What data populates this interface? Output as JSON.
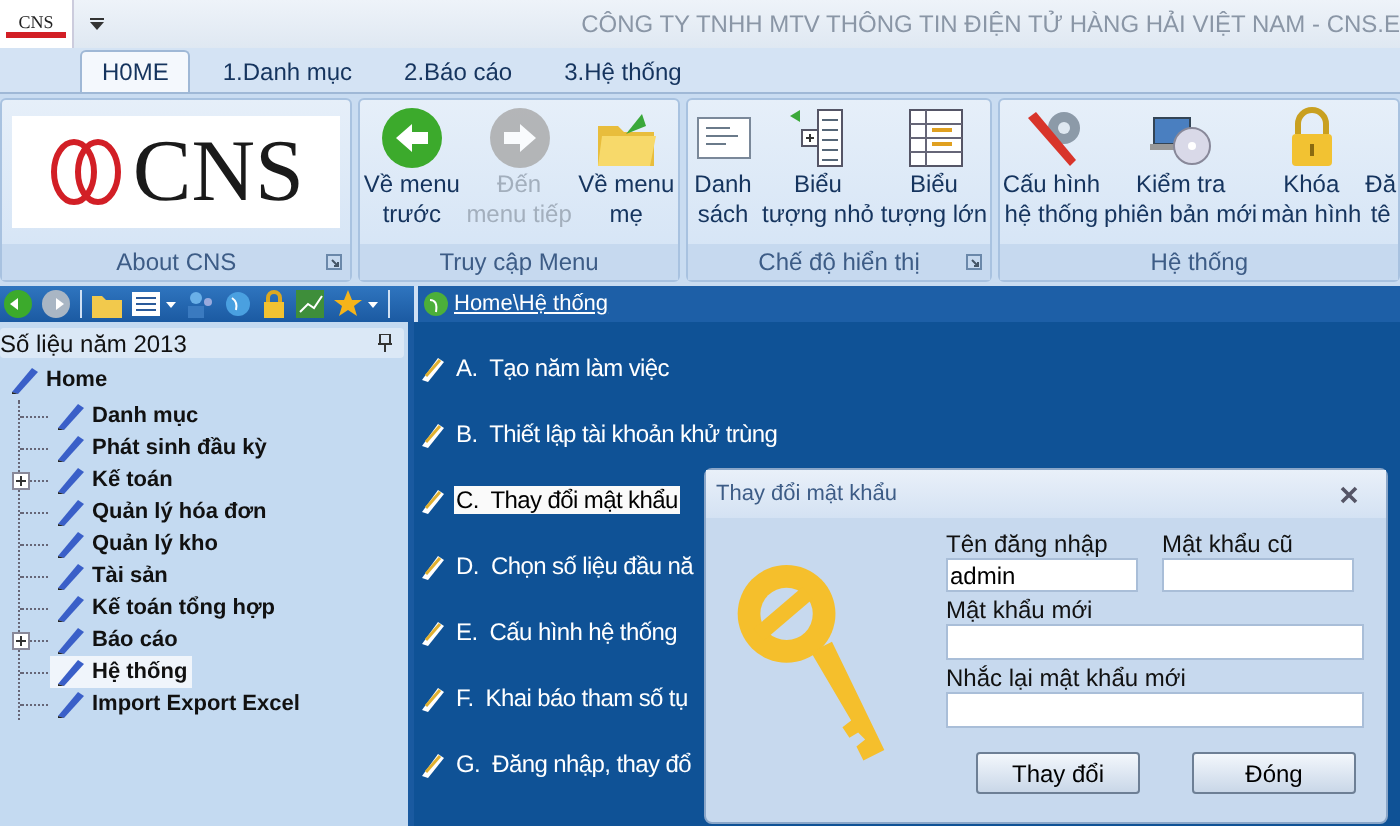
{
  "window": {
    "app_logo_text": "CNS",
    "title": "CÔNG TY TNHH MTV THÔNG TIN ĐIỆN TỬ HÀNG HẢI VIỆT NAM - CNS.E"
  },
  "tabs": [
    {
      "label": "H0ME",
      "selected": true
    },
    {
      "label": "1.Danh mục",
      "selected": false
    },
    {
      "label": "2.Báo cáo",
      "selected": false
    },
    {
      "label": "3.Hệ thống",
      "selected": false
    }
  ],
  "ribbon": [
    {
      "kind": "logo",
      "label": "About CNS",
      "logo_text": "CNS",
      "launcher": true
    },
    {
      "kind": "buttons",
      "label": "Truy cập Menu",
      "launcher": false,
      "buttons": [
        {
          "lines": [
            "Về menu",
            "trước"
          ],
          "disabled": false
        },
        {
          "lines": [
            "Đến",
            "menu tiếp"
          ],
          "disabled": true
        },
        {
          "lines": [
            "Về menu",
            "mẹ"
          ],
          "disabled": false
        }
      ]
    },
    {
      "kind": "buttons",
      "label": "Chế độ hiển thị",
      "launcher": true,
      "buttons": [
        {
          "lines": [
            "Danh",
            "sách"
          ],
          "disabled": false
        },
        {
          "lines": [
            "Biểu",
            "tượng nhỏ"
          ],
          "disabled": false
        },
        {
          "lines": [
            "Biểu",
            "tượng lớn"
          ],
          "disabled": false
        }
      ]
    },
    {
      "kind": "buttons",
      "label": "Hệ thống",
      "launcher": false,
      "buttons": [
        {
          "lines": [
            "Cấu hình",
            "hệ thống"
          ],
          "disabled": false
        },
        {
          "lines": [
            "Kiểm tra",
            "phiên bản mới"
          ],
          "disabled": false
        },
        {
          "lines": [
            "Khóa",
            "màn hình"
          ],
          "disabled": false
        },
        {
          "lines": [
            "Đă",
            "tê"
          ],
          "disabled": false
        }
      ]
    }
  ],
  "breadcrumb": "Home\\Hệ thống",
  "sidebar": {
    "title": "Số liệu năm 2013",
    "tree": [
      {
        "label": "Home",
        "selected": false,
        "children": [
          {
            "label": "Danh mục",
            "kind": "leaf",
            "selected": false
          },
          {
            "label": "Phát sinh đầu kỳ",
            "kind": "leaf",
            "selected": false
          },
          {
            "label": "Kế toán",
            "kind": "folder",
            "selected": false
          },
          {
            "label": "Quản lý hóa đơn",
            "kind": "leaf",
            "selected": false
          },
          {
            "label": "Quản lý kho",
            "kind": "leaf",
            "selected": false
          },
          {
            "label": "Tài sản",
            "kind": "leaf",
            "selected": false
          },
          {
            "label": "Kế toán tổng hợp",
            "kind": "leaf",
            "selected": false
          },
          {
            "label": "Báo cáo",
            "kind": "folder",
            "selected": false
          },
          {
            "label": "Hệ thống",
            "kind": "leaf",
            "selected": true
          },
          {
            "label": "Import Export Excel",
            "kind": "leaf",
            "selected": false
          }
        ]
      }
    ]
  },
  "menu_items": [
    {
      "letter": "A.",
      "text": "Tạo năm làm việc",
      "selected": false
    },
    {
      "letter": "B.",
      "text": "Thiết lập tài khoản khử trùng",
      "selected": false
    },
    {
      "letter": "C.",
      "text": "Thay đổi mật khẩu",
      "selected": true
    },
    {
      "letter": "D.",
      "text": "Chọn số liệu đầu nă",
      "selected": false
    },
    {
      "letter": "E.",
      "text": "Cấu hình hệ thống",
      "selected": false
    },
    {
      "letter": "F.",
      "text": "Khai báo tham số tụ",
      "selected": false
    },
    {
      "letter": "G.",
      "text": "Đăng nhập, thay đổ",
      "selected": false
    }
  ],
  "dialog": {
    "title": "Thay đổi mật khẩu",
    "fields": [
      {
        "label": "Tên đăng nhập",
        "value": "admin"
      },
      {
        "label": "Mật khẩu cũ"
      },
      {
        "label": "Mật khẩu mới"
      },
      {
        "label": "Nhắc lại mật khẩu mới"
      }
    ],
    "buttons": [
      "Thay đổi",
      "Đóng"
    ]
  }
}
